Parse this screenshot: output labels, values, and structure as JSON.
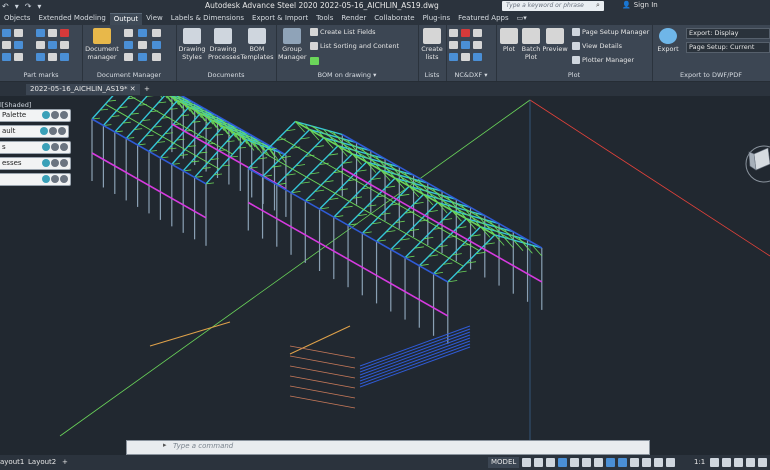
{
  "window": {
    "title": "Autodesk Advance Steel 2020   2022-05-16_AICHLIN_AS19.dwg"
  },
  "search": {
    "placeholder": "Type a keyword or phrase"
  },
  "account": {
    "signin": "Sign In"
  },
  "menu_tabs": [
    "Objects",
    "Extended Modeling",
    "Output",
    "View",
    "Labels & Dimensions",
    "Export & Import",
    "Tools",
    "Render",
    "Collaborate",
    "Plug-ins",
    "Featured Apps"
  ],
  "ribbon": {
    "part_marks": "Part marks",
    "document_manager_btn": "Document manager",
    "document_manager_panel": "Document Manager",
    "drawing_styles": "Drawing Styles",
    "drawing_processes": "Drawing Processes",
    "bom_templates": "BOM Templates",
    "documents_panel": "Documents",
    "group_manager": "Group Manager",
    "create_list_fields": "Create List Fields",
    "list_sorting": "List Sorting and Content",
    "bom_panel": "BOM on drawing",
    "create_lists": "Create lists",
    "lists_panel": "Lists",
    "nc_panel": "NC&DXF",
    "plot": "Plot",
    "batch_plot": "Batch Plot",
    "preview": "Preview",
    "page_setup_manager": "Page Setup Manager",
    "view_details": "View Details",
    "plotter_manager": "Plotter Manager",
    "plot_panel": "Plot",
    "export": "Export",
    "export_display": "Export: Display",
    "page_setup_current": "Page Setup: Current",
    "export_panel": "Export to DWF/PDF"
  },
  "file_tabs": {
    "active": "2022-05-16_AICHLIN_AS19*"
  },
  "viewport": {
    "label": "l[Shaded]",
    "palettes": [
      "Palette",
      "ault",
      "s",
      "esses",
      ""
    ]
  },
  "command": {
    "placeholder": "Type  a  command"
  },
  "status": {
    "layout1": "ayout1",
    "layout2": "Layout2",
    "model": "MODEL",
    "scale": "1:1"
  },
  "colors": {
    "cyan": "#34c6d8",
    "green": "#6bd65a",
    "blue": "#2f5bd6",
    "magenta": "#d63adf",
    "orange": "#e0a24a",
    "red": "#e6423a"
  }
}
